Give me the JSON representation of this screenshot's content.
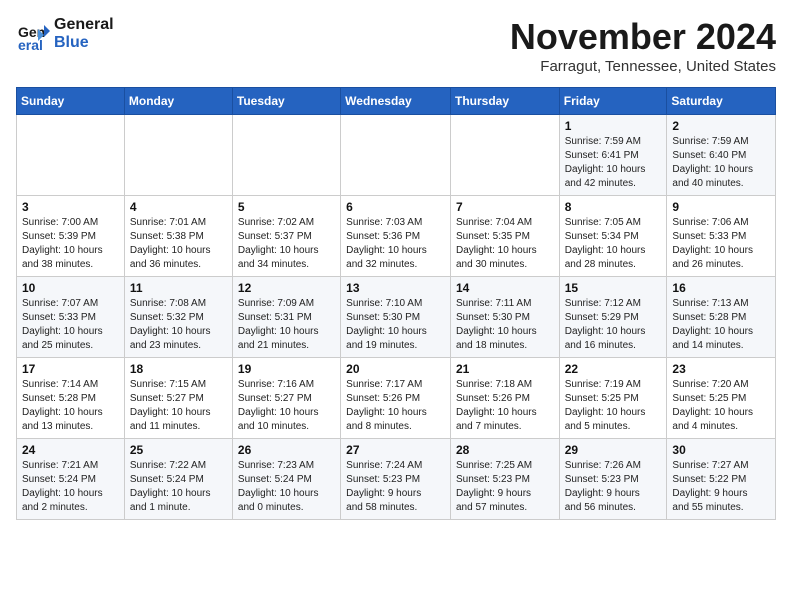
{
  "logo": {
    "part1": "General",
    "part2": "Blue"
  },
  "title": "November 2024",
  "location": "Farragut, Tennessee, United States",
  "days_header": [
    "Sunday",
    "Monday",
    "Tuesday",
    "Wednesday",
    "Thursday",
    "Friday",
    "Saturday"
  ],
  "weeks": [
    [
      {
        "day": "",
        "info": ""
      },
      {
        "day": "",
        "info": ""
      },
      {
        "day": "",
        "info": ""
      },
      {
        "day": "",
        "info": ""
      },
      {
        "day": "",
        "info": ""
      },
      {
        "day": "1",
        "info": "Sunrise: 7:59 AM\nSunset: 6:41 PM\nDaylight: 10 hours\nand 42 minutes."
      },
      {
        "day": "2",
        "info": "Sunrise: 7:59 AM\nSunset: 6:40 PM\nDaylight: 10 hours\nand 40 minutes."
      }
    ],
    [
      {
        "day": "3",
        "info": "Sunrise: 7:00 AM\nSunset: 5:39 PM\nDaylight: 10 hours\nand 38 minutes."
      },
      {
        "day": "4",
        "info": "Sunrise: 7:01 AM\nSunset: 5:38 PM\nDaylight: 10 hours\nand 36 minutes."
      },
      {
        "day": "5",
        "info": "Sunrise: 7:02 AM\nSunset: 5:37 PM\nDaylight: 10 hours\nand 34 minutes."
      },
      {
        "day": "6",
        "info": "Sunrise: 7:03 AM\nSunset: 5:36 PM\nDaylight: 10 hours\nand 32 minutes."
      },
      {
        "day": "7",
        "info": "Sunrise: 7:04 AM\nSunset: 5:35 PM\nDaylight: 10 hours\nand 30 minutes."
      },
      {
        "day": "8",
        "info": "Sunrise: 7:05 AM\nSunset: 5:34 PM\nDaylight: 10 hours\nand 28 minutes."
      },
      {
        "day": "9",
        "info": "Sunrise: 7:06 AM\nSunset: 5:33 PM\nDaylight: 10 hours\nand 26 minutes."
      }
    ],
    [
      {
        "day": "10",
        "info": "Sunrise: 7:07 AM\nSunset: 5:33 PM\nDaylight: 10 hours\nand 25 minutes."
      },
      {
        "day": "11",
        "info": "Sunrise: 7:08 AM\nSunset: 5:32 PM\nDaylight: 10 hours\nand 23 minutes."
      },
      {
        "day": "12",
        "info": "Sunrise: 7:09 AM\nSunset: 5:31 PM\nDaylight: 10 hours\nand 21 minutes."
      },
      {
        "day": "13",
        "info": "Sunrise: 7:10 AM\nSunset: 5:30 PM\nDaylight: 10 hours\nand 19 minutes."
      },
      {
        "day": "14",
        "info": "Sunrise: 7:11 AM\nSunset: 5:30 PM\nDaylight: 10 hours\nand 18 minutes."
      },
      {
        "day": "15",
        "info": "Sunrise: 7:12 AM\nSunset: 5:29 PM\nDaylight: 10 hours\nand 16 minutes."
      },
      {
        "day": "16",
        "info": "Sunrise: 7:13 AM\nSunset: 5:28 PM\nDaylight: 10 hours\nand 14 minutes."
      }
    ],
    [
      {
        "day": "17",
        "info": "Sunrise: 7:14 AM\nSunset: 5:28 PM\nDaylight: 10 hours\nand 13 minutes."
      },
      {
        "day": "18",
        "info": "Sunrise: 7:15 AM\nSunset: 5:27 PM\nDaylight: 10 hours\nand 11 minutes."
      },
      {
        "day": "19",
        "info": "Sunrise: 7:16 AM\nSunset: 5:27 PM\nDaylight: 10 hours\nand 10 minutes."
      },
      {
        "day": "20",
        "info": "Sunrise: 7:17 AM\nSunset: 5:26 PM\nDaylight: 10 hours\nand 8 minutes."
      },
      {
        "day": "21",
        "info": "Sunrise: 7:18 AM\nSunset: 5:26 PM\nDaylight: 10 hours\nand 7 minutes."
      },
      {
        "day": "22",
        "info": "Sunrise: 7:19 AM\nSunset: 5:25 PM\nDaylight: 10 hours\nand 5 minutes."
      },
      {
        "day": "23",
        "info": "Sunrise: 7:20 AM\nSunset: 5:25 PM\nDaylight: 10 hours\nand 4 minutes."
      }
    ],
    [
      {
        "day": "24",
        "info": "Sunrise: 7:21 AM\nSunset: 5:24 PM\nDaylight: 10 hours\nand 2 minutes."
      },
      {
        "day": "25",
        "info": "Sunrise: 7:22 AM\nSunset: 5:24 PM\nDaylight: 10 hours\nand 1 minute."
      },
      {
        "day": "26",
        "info": "Sunrise: 7:23 AM\nSunset: 5:24 PM\nDaylight: 10 hours\nand 0 minutes."
      },
      {
        "day": "27",
        "info": "Sunrise: 7:24 AM\nSunset: 5:23 PM\nDaylight: 9 hours\nand 58 minutes."
      },
      {
        "day": "28",
        "info": "Sunrise: 7:25 AM\nSunset: 5:23 PM\nDaylight: 9 hours\nand 57 minutes."
      },
      {
        "day": "29",
        "info": "Sunrise: 7:26 AM\nSunset: 5:23 PM\nDaylight: 9 hours\nand 56 minutes."
      },
      {
        "day": "30",
        "info": "Sunrise: 7:27 AM\nSunset: 5:22 PM\nDaylight: 9 hours\nand 55 minutes."
      }
    ]
  ]
}
